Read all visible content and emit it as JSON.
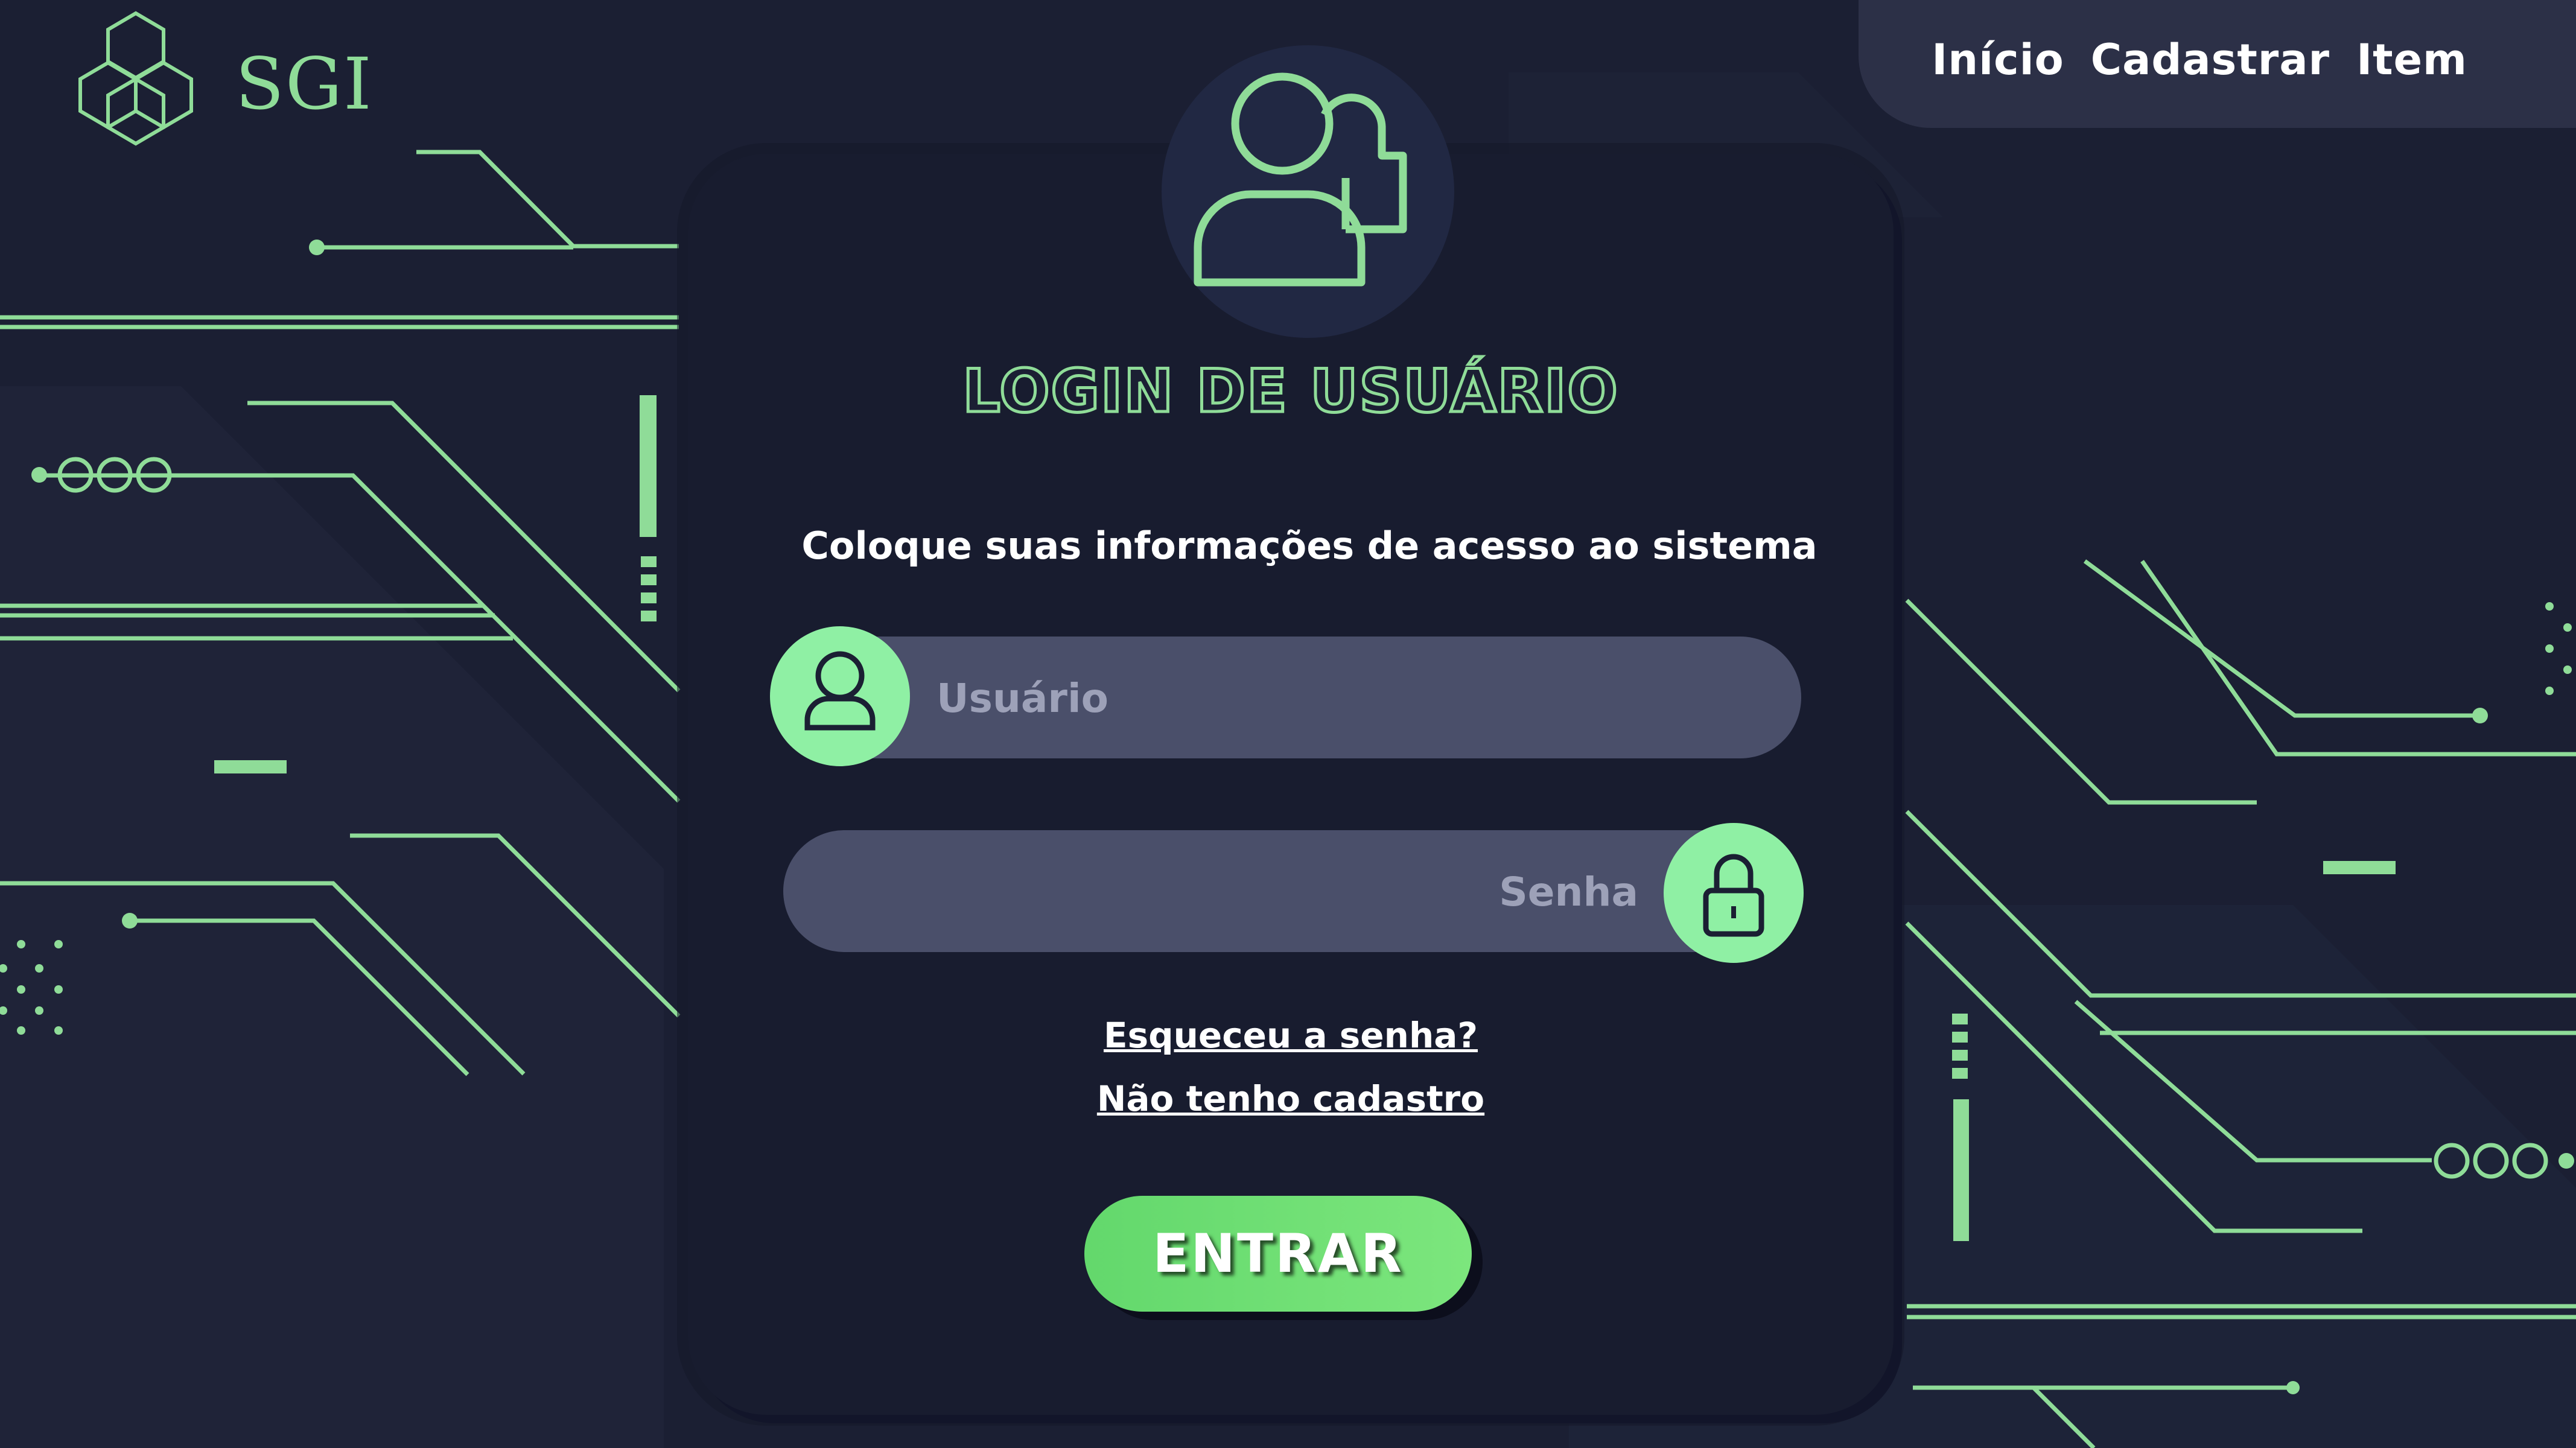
{
  "app": {
    "brand": "SGI"
  },
  "nav": {
    "items": [
      "Início",
      "Cadastrar",
      "Item"
    ]
  },
  "login": {
    "title": "LOGIN DE USUÁRIO",
    "subtitle": "Coloque suas informações de acesso ao sistema",
    "username_placeholder": "Usuário",
    "password_placeholder": "Senha",
    "forgot_link": "Esqueceu a senha?",
    "register_link": "Não tenho cadastro",
    "submit_label": "ENTRAR"
  },
  "icons": {
    "logo": "hexagon-cluster-logo",
    "avatar": "users-group-icon",
    "username": "user-icon",
    "password": "lock-icon"
  },
  "colors": {
    "accent": "#8fdc98",
    "icon_bg": "#8ff0a4",
    "button": "#6ade72",
    "background": "#1b1f33",
    "card": "#181c2f",
    "field": "#4a4f6a"
  }
}
